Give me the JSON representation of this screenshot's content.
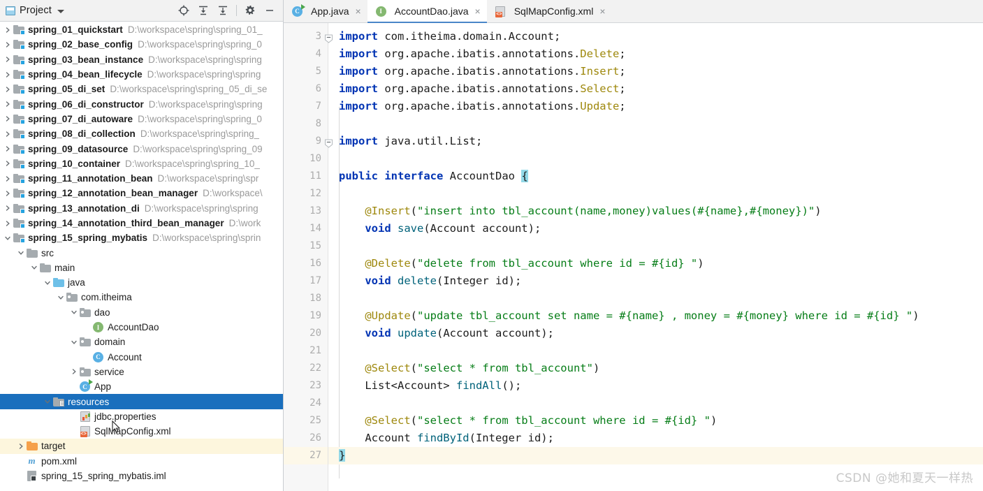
{
  "window": {
    "watermark": "CSDN @她和夏天一样热"
  },
  "project_panel": {
    "title": "Project",
    "dropdown_icon": "chevron-down-icon",
    "toolbar": [
      {
        "name": "locate-icon",
        "tooltip": "Select Opened File"
      },
      {
        "name": "expand-all-icon",
        "tooltip": "Expand All"
      },
      {
        "name": "collapse-all-icon",
        "tooltip": "Collapse All"
      },
      {
        "name": "gear-icon",
        "tooltip": "Settings"
      },
      {
        "name": "minimize-icon",
        "tooltip": "Hide"
      }
    ],
    "tree": [
      {
        "label": "spring_01_quickstart",
        "path": "D:\\workspace\\spring\\spring_01_",
        "indent": 0,
        "twisty": "right",
        "icon": "module-folder-icon",
        "bold": true
      },
      {
        "label": "spring_02_base_config",
        "path": "D:\\workspace\\spring\\spring_0",
        "indent": 0,
        "twisty": "right",
        "icon": "module-folder-icon",
        "bold": true
      },
      {
        "label": "spring_03_bean_instance",
        "path": "D:\\workspace\\spring\\spring",
        "indent": 0,
        "twisty": "right",
        "icon": "module-folder-icon",
        "bold": true
      },
      {
        "label": "spring_04_bean_lifecycle",
        "path": "D:\\workspace\\spring\\spring",
        "indent": 0,
        "twisty": "right",
        "icon": "module-folder-icon",
        "bold": true
      },
      {
        "label": "spring_05_di_set",
        "path": "D:\\workspace\\spring\\spring_05_di_se",
        "indent": 0,
        "twisty": "right",
        "icon": "module-folder-icon",
        "bold": true
      },
      {
        "label": "spring_06_di_constructor",
        "path": "D:\\workspace\\spring\\spring",
        "indent": 0,
        "twisty": "right",
        "icon": "module-folder-icon",
        "bold": true
      },
      {
        "label": "spring_07_di_autoware",
        "path": "D:\\workspace\\spring\\spring_0",
        "indent": 0,
        "twisty": "right",
        "icon": "module-folder-icon",
        "bold": true
      },
      {
        "label": "spring_08_di_collection",
        "path": "D:\\workspace\\spring\\spring_",
        "indent": 0,
        "twisty": "right",
        "icon": "module-folder-icon",
        "bold": true
      },
      {
        "label": "spring_09_datasource",
        "path": "D:\\workspace\\spring\\spring_09",
        "indent": 0,
        "twisty": "right",
        "icon": "module-folder-icon",
        "bold": true
      },
      {
        "label": "spring_10_container",
        "path": "D:\\workspace\\spring\\spring_10_",
        "indent": 0,
        "twisty": "right",
        "icon": "module-folder-icon",
        "bold": true
      },
      {
        "label": "spring_11_annotation_bean",
        "path": "D:\\workspace\\spring\\spr",
        "indent": 0,
        "twisty": "right",
        "icon": "module-folder-icon",
        "bold": true
      },
      {
        "label": "spring_12_annotation_bean_manager",
        "path": "D:\\workspace\\",
        "indent": 0,
        "twisty": "right",
        "icon": "module-folder-icon",
        "bold": true
      },
      {
        "label": "spring_13_annotation_di",
        "path": "D:\\workspace\\spring\\spring",
        "indent": 0,
        "twisty": "right",
        "icon": "module-folder-icon",
        "bold": true
      },
      {
        "label": "spring_14_annotation_third_bean_manager",
        "path": "D:\\work",
        "indent": 0,
        "twisty": "right",
        "icon": "module-folder-icon",
        "bold": true
      },
      {
        "label": "spring_15_spring_mybatis",
        "path": "D:\\workspace\\spring\\sprin",
        "indent": 0,
        "twisty": "down",
        "icon": "module-folder-icon",
        "bold": true
      },
      {
        "label": "src",
        "path": "",
        "indent": 1,
        "twisty": "down",
        "icon": "folder-gray-icon",
        "bold": false
      },
      {
        "label": "main",
        "path": "",
        "indent": 2,
        "twisty": "down",
        "icon": "folder-gray-icon",
        "bold": false
      },
      {
        "label": "java",
        "path": "",
        "indent": 3,
        "twisty": "down",
        "icon": "folder-blue-icon",
        "bold": false
      },
      {
        "label": "com.itheima",
        "path": "",
        "indent": 4,
        "twisty": "down",
        "icon": "package-icon",
        "bold": false
      },
      {
        "label": "dao",
        "path": "",
        "indent": 5,
        "twisty": "down",
        "icon": "package-icon",
        "bold": false
      },
      {
        "label": "AccountDao",
        "path": "",
        "indent": 6,
        "twisty": "none",
        "icon": "interface-icon",
        "bold": false
      },
      {
        "label": "domain",
        "path": "",
        "indent": 5,
        "twisty": "down",
        "icon": "package-icon",
        "bold": false
      },
      {
        "label": "Account",
        "path": "",
        "indent": 6,
        "twisty": "none",
        "icon": "class-icon",
        "bold": false
      },
      {
        "label": "service",
        "path": "",
        "indent": 5,
        "twisty": "right",
        "icon": "package-icon",
        "bold": false
      },
      {
        "label": "App",
        "path": "",
        "indent": 5,
        "twisty": "none",
        "icon": "runnable-class-icon",
        "bold": false
      },
      {
        "label": "resources",
        "path": "",
        "indent": 3,
        "twisty": "down",
        "icon": "resources-folder-icon",
        "bold": false,
        "state": "selected"
      },
      {
        "label": "jdbc.properties",
        "path": "",
        "indent": 5,
        "twisty": "none",
        "icon": "properties-file-icon",
        "bold": false
      },
      {
        "label": "SqlMapConfig.xml",
        "path": "",
        "indent": 5,
        "twisty": "none",
        "icon": "xml-file-icon",
        "bold": false
      },
      {
        "label": "target",
        "path": "",
        "indent": 1,
        "twisty": "right",
        "icon": "folder-orange-icon",
        "bold": false,
        "state": "highlighted"
      },
      {
        "label": "pom.xml",
        "path": "",
        "indent": 1,
        "twisty": "none",
        "icon": "maven-icon",
        "bold": false
      },
      {
        "label": "spring_15_spring_mybatis.iml",
        "path": "",
        "indent": 1,
        "twisty": "none",
        "icon": "iml-file-icon",
        "bold": false
      }
    ]
  },
  "editor": {
    "tabs": [
      {
        "label": "App.java",
        "icon": "runnable-class-icon",
        "active": false,
        "close_glyph": "×"
      },
      {
        "label": "AccountDao.java",
        "icon": "interface-icon",
        "active": true,
        "close_glyph": "×"
      },
      {
        "label": "SqlMapConfig.xml",
        "icon": "xml-file-icon",
        "active": false,
        "close_glyph": "×"
      }
    ],
    "file": "AccountDao.java",
    "first_visible_line": 3,
    "caret_line": 27,
    "line_numbers": [
      3,
      4,
      5,
      6,
      7,
      8,
      9,
      10,
      11,
      12,
      13,
      14,
      15,
      16,
      17,
      18,
      19,
      20,
      21,
      22,
      23,
      24,
      25,
      26,
      27
    ],
    "fold_marker_lines": [
      3,
      9
    ],
    "code_lines": [
      {
        "n": 3,
        "tokens": [
          {
            "t": "import",
            "c": "kw"
          },
          {
            "t": " com.itheima.domain.Account;",
            "c": "cls-n"
          }
        ]
      },
      {
        "n": 4,
        "tokens": [
          {
            "t": "import",
            "c": "kw"
          },
          {
            "t": " org.apache.ibatis.annotations.",
            "c": "cls-n"
          },
          {
            "t": "Delete",
            "c": "anno"
          },
          {
            "t": ";",
            "c": "cls-n"
          }
        ]
      },
      {
        "n": 5,
        "tokens": [
          {
            "t": "import",
            "c": "kw"
          },
          {
            "t": " org.apache.ibatis.annotations.",
            "c": "cls-n"
          },
          {
            "t": "Insert",
            "c": "anno"
          },
          {
            "t": ";",
            "c": "cls-n"
          }
        ]
      },
      {
        "n": 6,
        "tokens": [
          {
            "t": "import",
            "c": "kw"
          },
          {
            "t": " org.apache.ibatis.annotations.",
            "c": "cls-n"
          },
          {
            "t": "Select",
            "c": "anno"
          },
          {
            "t": ";",
            "c": "cls-n"
          }
        ]
      },
      {
        "n": 7,
        "tokens": [
          {
            "t": "import",
            "c": "kw"
          },
          {
            "t": " org.apache.ibatis.annotations.",
            "c": "cls-n"
          },
          {
            "t": "Update",
            "c": "anno"
          },
          {
            "t": ";",
            "c": "cls-n"
          }
        ]
      },
      {
        "n": 8,
        "tokens": []
      },
      {
        "n": 9,
        "tokens": [
          {
            "t": "import",
            "c": "kw"
          },
          {
            "t": " java.util.List;",
            "c": "cls-n"
          }
        ]
      },
      {
        "n": 10,
        "tokens": []
      },
      {
        "n": 11,
        "tokens": [
          {
            "t": "public",
            "c": "kw"
          },
          {
            "t": " ",
            "c": "cls-n"
          },
          {
            "t": "interface",
            "c": "kw"
          },
          {
            "t": " AccountDao ",
            "c": "cls-n"
          },
          {
            "t": "{",
            "c": "brace-hl"
          }
        ]
      },
      {
        "n": 12,
        "tokens": []
      },
      {
        "n": 13,
        "tokens": [
          {
            "t": "    ",
            "c": "cls-n"
          },
          {
            "t": "@Insert",
            "c": "anno"
          },
          {
            "t": "(",
            "c": "cls-n"
          },
          {
            "t": "\"insert into tbl_account(name,money)values(#{name},#{money})\"",
            "c": "str"
          },
          {
            "t": ")",
            "c": "cls-n"
          }
        ]
      },
      {
        "n": 14,
        "tokens": [
          {
            "t": "    ",
            "c": "cls-n"
          },
          {
            "t": "void",
            "c": "kw"
          },
          {
            "t": " ",
            "c": "cls-n"
          },
          {
            "t": "save",
            "c": "meth"
          },
          {
            "t": "(Account account);",
            "c": "cls-n"
          }
        ]
      },
      {
        "n": 15,
        "tokens": []
      },
      {
        "n": 16,
        "tokens": [
          {
            "t": "    ",
            "c": "cls-n"
          },
          {
            "t": "@Delete",
            "c": "anno"
          },
          {
            "t": "(",
            "c": "cls-n"
          },
          {
            "t": "\"delete from tbl_account where id = #{id} \"",
            "c": "str"
          },
          {
            "t": ")",
            "c": "cls-n"
          }
        ]
      },
      {
        "n": 17,
        "tokens": [
          {
            "t": "    ",
            "c": "cls-n"
          },
          {
            "t": "void",
            "c": "kw"
          },
          {
            "t": " ",
            "c": "cls-n"
          },
          {
            "t": "delete",
            "c": "meth"
          },
          {
            "t": "(Integer id);",
            "c": "cls-n"
          }
        ]
      },
      {
        "n": 18,
        "tokens": []
      },
      {
        "n": 19,
        "tokens": [
          {
            "t": "    ",
            "c": "cls-n"
          },
          {
            "t": "@Update",
            "c": "anno"
          },
          {
            "t": "(",
            "c": "cls-n"
          },
          {
            "t": "\"update tbl_account set name = #{name} , money = #{money} where id = #{id} \"",
            "c": "str"
          },
          {
            "t": ")",
            "c": "cls-n"
          }
        ]
      },
      {
        "n": 20,
        "tokens": [
          {
            "t": "    ",
            "c": "cls-n"
          },
          {
            "t": "void",
            "c": "kw"
          },
          {
            "t": " ",
            "c": "cls-n"
          },
          {
            "t": "update",
            "c": "meth"
          },
          {
            "t": "(Account account);",
            "c": "cls-n"
          }
        ]
      },
      {
        "n": 21,
        "tokens": []
      },
      {
        "n": 22,
        "tokens": [
          {
            "t": "    ",
            "c": "cls-n"
          },
          {
            "t": "@Select",
            "c": "anno"
          },
          {
            "t": "(",
            "c": "cls-n"
          },
          {
            "t": "\"select * from tbl_account\"",
            "c": "str"
          },
          {
            "t": ")",
            "c": "cls-n"
          }
        ]
      },
      {
        "n": 23,
        "tokens": [
          {
            "t": "    List<Account> ",
            "c": "cls-n"
          },
          {
            "t": "findAll",
            "c": "meth"
          },
          {
            "t": "();",
            "c": "cls-n"
          }
        ]
      },
      {
        "n": 24,
        "tokens": []
      },
      {
        "n": 25,
        "tokens": [
          {
            "t": "    ",
            "c": "cls-n"
          },
          {
            "t": "@Select",
            "c": "anno"
          },
          {
            "t": "(",
            "c": "cls-n"
          },
          {
            "t": "\"select * from tbl_account where id = #{id} \"",
            "c": "str"
          },
          {
            "t": ")",
            "c": "cls-n"
          }
        ]
      },
      {
        "n": 26,
        "tokens": [
          {
            "t": "    Account ",
            "c": "cls-n"
          },
          {
            "t": "findById",
            "c": "meth"
          },
          {
            "t": "(Integer id);",
            "c": "cls-n"
          }
        ]
      },
      {
        "n": 27,
        "tokens": [
          {
            "t": "}",
            "c": "brace-hl"
          }
        ]
      }
    ]
  },
  "colors": {
    "selection_blue": "#1a6fbd",
    "caret_line": "#fdf8e9",
    "keyword": "#0033b3",
    "string": "#067d17",
    "annotation": "#9e880d",
    "method": "#00627a",
    "tab_underline": "#4a86c8",
    "target_highlight": "#fdf6dd"
  }
}
